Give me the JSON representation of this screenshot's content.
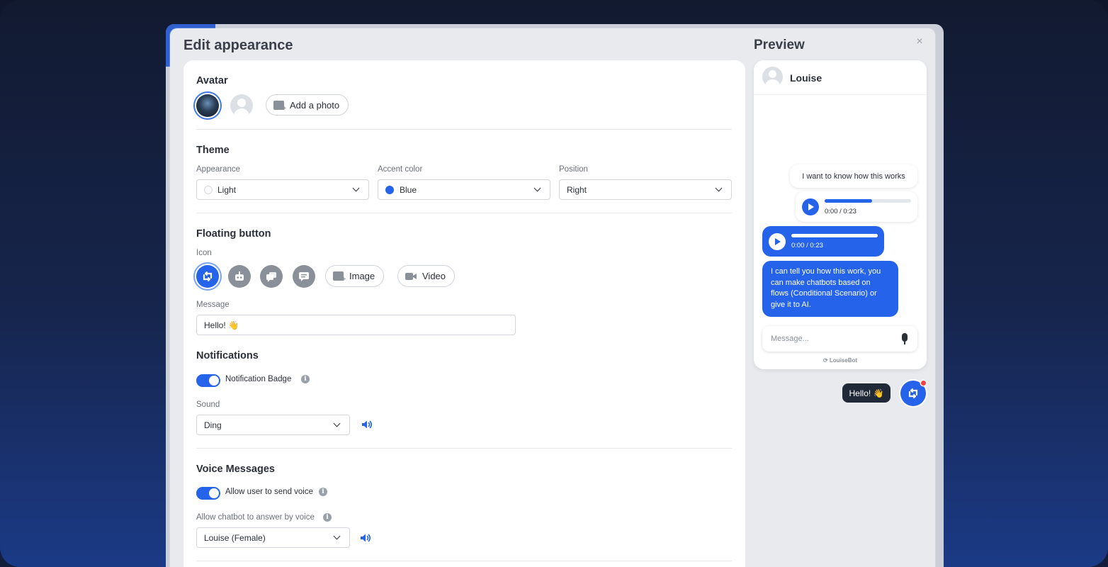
{
  "modal": {
    "title": "Edit appearance",
    "preview_title": "Preview",
    "close_label": "×"
  },
  "avatar": {
    "section_title": "Avatar",
    "add_photo_label": "Add a photo"
  },
  "theme": {
    "section_title": "Theme",
    "appearance": {
      "label": "Appearance",
      "value": "Light"
    },
    "accent_color": {
      "label": "Accent color",
      "value": "Blue",
      "hex": "#2563eb"
    },
    "position": {
      "label": "Position",
      "value": "Right"
    }
  },
  "floating_button": {
    "section_title": "Floating button",
    "icon_label": "Icon",
    "icons": [
      "chat-loop-icon",
      "robot-icon",
      "chat-bubbles-icon",
      "message-icon"
    ],
    "image_button": "Image",
    "video_button": "Video",
    "message_label": "Message",
    "message_value": "Hello! 👋"
  },
  "notifications": {
    "section_title": "Notifications",
    "badge_label": "Notification Badge",
    "badge_enabled": true,
    "sound_label": "Sound",
    "sound_value": "Ding"
  },
  "voice": {
    "section_title": "Voice Messages",
    "allow_user_label": "Allow user to send voice",
    "allow_user_enabled": true,
    "bot_voice_label": "Allow chatbot to answer by voice",
    "bot_voice_value": "Louise (Female)"
  },
  "preview": {
    "bot_name": "Louise",
    "user_message": "I want to know how this works",
    "user_audio_time": "0:00 / 0:23",
    "user_audio_progress": 0.55,
    "bot_audio_time": "0:00 / 0:23",
    "bot_message": "I can tell you how this work, you can make chatbots based on flows (Conditional Scenario) or give it to AI.",
    "input_placeholder": "Message...",
    "brand": "LouiseBot",
    "tooltip": "Hello! 👋"
  },
  "colors": {
    "accent": "#2563eb",
    "badge_dot": "#ef4444"
  }
}
